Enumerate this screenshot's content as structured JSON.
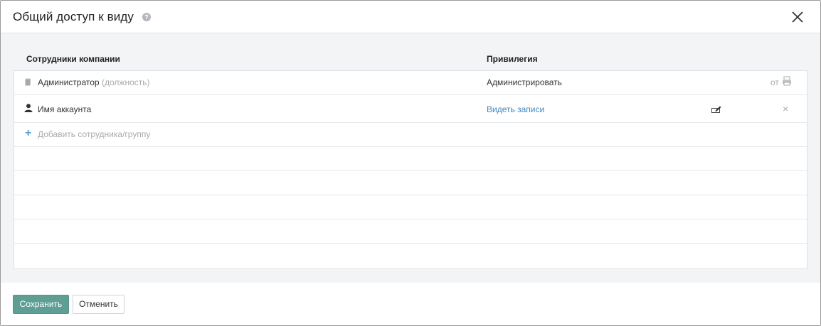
{
  "dialog": {
    "title": "Общий доступ к виду",
    "help_icon_glyph": "?"
  },
  "table": {
    "columns": {
      "employees": "Сотрудники компании",
      "privilege": "Привилегия"
    },
    "rows": [
      {
        "icon": "document-icon",
        "name": "Администратор",
        "note": "(должность)",
        "privilege": "Администрировать",
        "extra_label": "от",
        "extra_icon": "printer-icon"
      },
      {
        "icon": "user-icon",
        "name": "Имя аккаунта",
        "privilege": "Видеть записи",
        "action_icon": "edit-icon",
        "remove_glyph": "×"
      }
    ],
    "add_row": {
      "icon_glyph": "+",
      "label": "Добавить сотрудника/группу"
    },
    "empty_rows": 5
  },
  "footer": {
    "save_label": "Сохранить",
    "cancel_label": "Отменить"
  },
  "colors": {
    "save_button": "#5e9e94",
    "link": "#3d88c4",
    "body_background": "#f3f4f6"
  }
}
